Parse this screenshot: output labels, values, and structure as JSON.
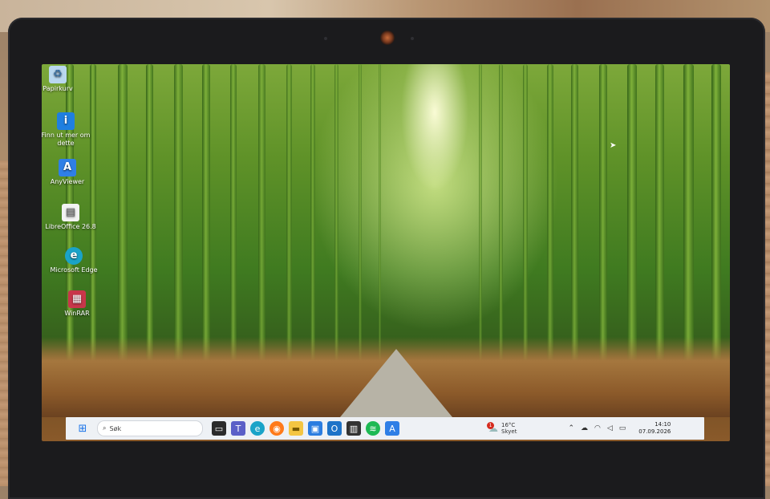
{
  "desktop": {
    "icons": [
      {
        "label": "Papirkurv",
        "icon": "recycle-bin-icon",
        "color": "#b9d7ef"
      },
      {
        "label": "Finn ut mer om dette",
        "icon": "learn-more-icon",
        "color": "#1f7fe0"
      },
      {
        "label": "AnyViewer",
        "icon": "anyviewer-icon",
        "color": "#2f7fe6"
      },
      {
        "label": "LibreOffice 26.8",
        "icon": "libreoffice-icon",
        "color": "#f3f3f3"
      },
      {
        "label": "Microsoft Edge",
        "icon": "edge-icon",
        "color": "#1aa3c8"
      },
      {
        "label": "WinRAR",
        "icon": "winrar-icon",
        "color": "#c8364a"
      }
    ]
  },
  "taskbar": {
    "search_placeholder": "Søk",
    "apps": [
      {
        "icon": "task-view-icon",
        "color": "#2b2b2b"
      },
      {
        "icon": "teams-icon",
        "color": "#5b5fc7"
      },
      {
        "icon": "edge-icon",
        "color": "#1aa3c8"
      },
      {
        "icon": "firefox-icon",
        "color": "#ff7a1a"
      },
      {
        "icon": "file-explorer-icon",
        "color": "#f4c542"
      },
      {
        "icon": "store-icon",
        "color": "#2b7de0"
      },
      {
        "icon": "outlook-icon",
        "color": "#1e73c8"
      },
      {
        "icon": "clapperboard-icon",
        "color": "#333333"
      },
      {
        "icon": "spotify-icon",
        "color": "#1db954"
      },
      {
        "icon": "anyviewer-icon",
        "color": "#2f7fe6"
      }
    ],
    "weather": {
      "temperature": "16°C",
      "condition": "Skyet",
      "badge": "1"
    },
    "clock": {
      "time": "14:10",
      "date": "07.09.2026"
    }
  }
}
